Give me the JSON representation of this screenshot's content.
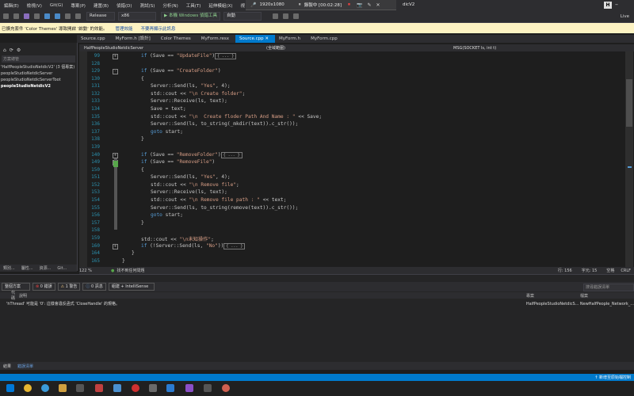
{
  "menubar": {
    "items": [
      "編輯(E)",
      "檢視(V)",
      "Git(G)",
      "專案(P)",
      "建置(B)",
      "偵錯(D)",
      "測試(S)",
      "分析(N)",
      "工具(T)",
      "延伸模組(X)",
      "視"
    ],
    "recording": {
      "resolution": "1920x1080",
      "status": "錄製中 [00:02:28]"
    },
    "title": "dicV2",
    "account_badge": "H"
  },
  "toolbar": {
    "config": "Release",
    "platform": "x86",
    "run_label": "▶ 本機 Windows 偵錯工具",
    "auto": "自動",
    "live_share": "Live"
  },
  "infobar": {
    "message": "已擴充套件 'Color Themes' 導致開啟 '啟動' 的效能。",
    "link1": "管理效能",
    "link2": "不要再顯示此訊息"
  },
  "tabs": [
    "Source.cpp",
    "MyForm.h [設計]",
    "Color Themes",
    "MyForm.resx",
    "Source.cpp",
    "MyForm.h",
    "MyForm.cpp"
  ],
  "active_tab_index": 4,
  "solution": {
    "search_label": "方案總管",
    "items": [
      "'HalfPeopleStudioNetdicV2' (3 個專案)",
      "peopleStudioNetdicServer",
      "peopleStudioNetdicServerToot",
      "peopleStudioNetdicV2"
    ]
  },
  "left_tabs": [
    "類別...",
    "屬性...",
    "資源...",
    "Git..."
  ],
  "editor": {
    "project": "HalfPeopleStudioNetdicServer",
    "scope": "(全域範圍)",
    "member": "MSG(SOCKET ls, int t)",
    "lines": [
      {
        "n": "99",
        "fold": "+",
        "html": "<span class='kw'>if</span> (Save == <span class='str'>\"UpdateFile\"</span>)<span class='collapsed'>{ ... }</span>",
        "indent": 2
      },
      {
        "n": "128",
        "fold": "",
        "html": "",
        "indent": 0
      },
      {
        "n": "129",
        "fold": "-",
        "html": "<span class='kw'>if</span> (Save == <span class='str'>\"CreateFolder\"</span>)",
        "indent": 2
      },
      {
        "n": "130",
        "fold": "",
        "html": "{",
        "indent": 2
      },
      {
        "n": "131",
        "fold": "",
        "html": "Server::Send(ls, <span class='str'>\"Yes\"</span>, 4);",
        "indent": 3
      },
      {
        "n": "132",
        "fold": "",
        "html": "std::cout &lt;&lt; <span class='str'>\"\\n Create folder\"</span>;",
        "indent": 3
      },
      {
        "n": "133",
        "fold": "",
        "html": "Server::Receive(ls, text);",
        "indent": 3
      },
      {
        "n": "134",
        "fold": "",
        "html": "Save = text;",
        "indent": 3
      },
      {
        "n": "135",
        "fold": "",
        "html": "std::cout &lt;&lt; <span class='str'>\"\\n  Create floder Path And Name : \"</span> &lt;&lt; Save;",
        "indent": 3
      },
      {
        "n": "136",
        "fold": "",
        "html": "Server::Send(ls, to_string(_mkdir(text)).c_str());",
        "indent": 3
      },
      {
        "n": "137",
        "fold": "",
        "html": "<span class='kw'>goto</span> start;",
        "indent": 3
      },
      {
        "n": "138",
        "fold": "",
        "html": "}",
        "indent": 2
      },
      {
        "n": "139",
        "fold": "",
        "html": "",
        "indent": 0
      },
      {
        "n": "140",
        "fold": "+",
        "html": "<span class='kw'>if</span> (Save == <span class='str'>\"RemoveFolder\"</span>)<span class='collapsed'>{ ... }</span>",
        "indent": 2
      },
      {
        "n": "149",
        "fold": "-",
        "html": "<span class='kw'>if</span> (Save == <span class='str'>\"RemoveFile\"</span>)",
        "indent": 2
      },
      {
        "n": "150",
        "fold": "",
        "html": "{",
        "indent": 2
      },
      {
        "n": "151",
        "fold": "",
        "html": "Server::Send(ls, <span class='str'>\"Yes\"</span>, 4);",
        "indent": 3
      },
      {
        "n": "152",
        "fold": "",
        "html": "std::cout &lt;&lt; <span class='str'>\"\\n Remove file\"</span>;",
        "indent": 3
      },
      {
        "n": "153",
        "fold": "",
        "html": "Server::Receive(ls, text);",
        "indent": 3
      },
      {
        "n": "154",
        "fold": "",
        "html": "std::cout &lt;&lt; <span class='str'>\"\\n Remove file path : \"</span> &lt;&lt; text;",
        "indent": 3
      },
      {
        "n": "155",
        "fold": "",
        "html": "Server::Send(ls, to_string(remove(text)).c_str());",
        "indent": 3
      },
      {
        "n": "156",
        "fold": "",
        "html": "<span class='kw'>goto</span> start;",
        "indent": 3
      },
      {
        "n": "157",
        "fold": "",
        "html": "}",
        "indent": 2
      },
      {
        "n": "158",
        "fold": "",
        "html": "",
        "indent": 0
      },
      {
        "n": "159",
        "fold": "",
        "html": "std::cout &lt;&lt; <span class='str'>\"\\n未知操作\"</span>;",
        "indent": 2
      },
      {
        "n": "160",
        "fold": "+",
        "html": "<span class='kw'>if</span> (!Server::Send(ls, <span class='str'>\"No\"</span>))<span class='collapsed'>{ ... }</span>",
        "indent": 2
      },
      {
        "n": "164",
        "fold": "",
        "html": "}",
        "indent": 1
      },
      {
        "n": "165",
        "fold": "",
        "html": "}",
        "indent": 0
      }
    ]
  },
  "ed_status": {
    "zoom": "122 %",
    "issues": "找不到任何問題",
    "line": "行: 156",
    "char": "字元: 15",
    "spaces": "空格",
    "crlf": "CRLF"
  },
  "errors": {
    "scope": "整個方案",
    "errors": "0 錯誤",
    "warnings": "1 警告",
    "messages": "0 訊息",
    "filter": "組建 + IntelliSense",
    "search": "搜尋錯誤清單",
    "headers": {
      "code": "代碼",
      "desc": "說明",
      "project": "專案",
      "file": "檔案",
      "line": "行"
    },
    "row": {
      "desc": "'hThread' 可能是 '0': 這樣會違反函式 'CloseHandle' 的規格。",
      "project": "HalfPeopleStudioNetdicS...",
      "file": "NewHalfPeople_Network_..."
    }
  },
  "bottom_tabs": [
    "結果",
    "錯誤清單"
  ],
  "statusbar": {
    "right": "↑ 新增至原始檔控制"
  },
  "colors": {
    "accent": "#007acc",
    "keyword": "#569cd6",
    "string": "#d69d85",
    "line_number": "#2b91af"
  }
}
